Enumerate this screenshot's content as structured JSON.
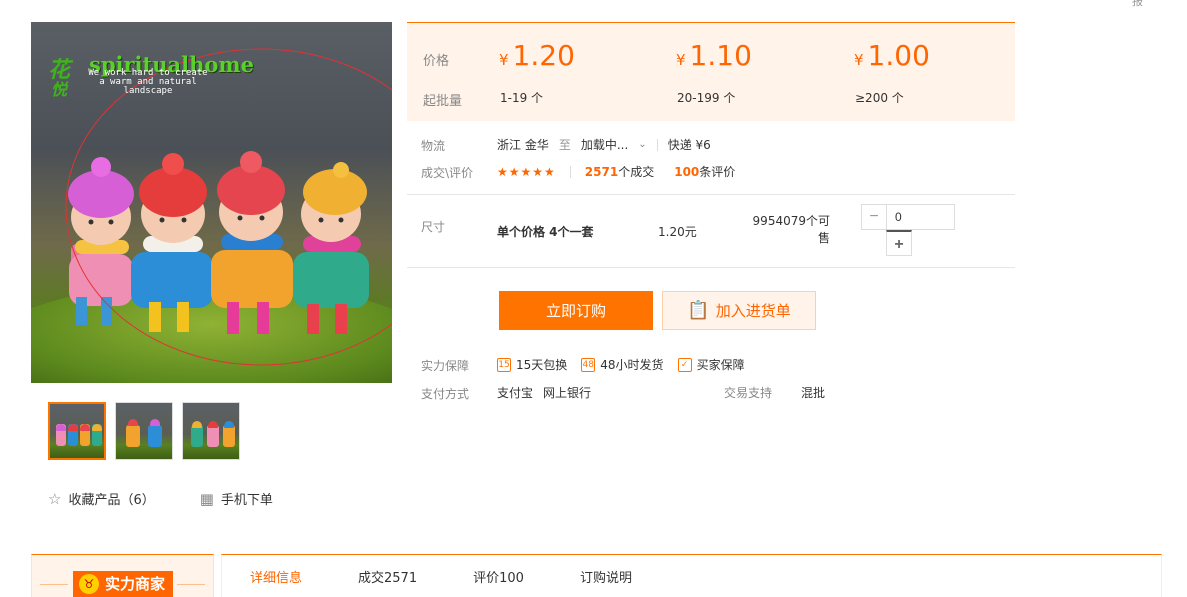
{
  "corner_text": "报",
  "brand": {
    "name": "spiritualhome",
    "tagline": "We work hard to create a warm and natural landscape",
    "glyph_1": "花",
    "glyph_2": "悦"
  },
  "thumbnails": [
    {
      "name": "thumb-1",
      "active": true
    },
    {
      "name": "thumb-2",
      "active": false
    },
    {
      "name": "thumb-3",
      "active": false
    }
  ],
  "actions": {
    "favorite_label": "收藏产品（6）",
    "mobile_label": "手机下单"
  },
  "price": {
    "price_label": "价格",
    "min_label": "起批量",
    "currency": "¥",
    "tiers": [
      {
        "price": "1.20",
        "qty": "1-19 个"
      },
      {
        "price": "1.10",
        "qty": "20-199 个"
      },
      {
        "price": "1.00",
        "qty": "≥200 个"
      }
    ]
  },
  "logistics": {
    "label": "物流",
    "from": "浙江 金华",
    "to_word": "至",
    "dest": "加载中...",
    "shipping": "快递 ¥6"
  },
  "deal": {
    "label": "成交\\评价",
    "stars": "★★★★★",
    "deal_count": "2571",
    "deal_suffix": "个成交",
    "review_count": "100",
    "review_suffix": "条评价"
  },
  "sku": {
    "label": "尺寸",
    "name": "单个价格 4个一套",
    "price": "1.20元",
    "stock": "9954079个可售",
    "qty_value": "0",
    "minus": "−",
    "plus": "+"
  },
  "buttons": {
    "order": "立即订购",
    "cart": "加入进货单"
  },
  "guarantee": {
    "label": "实力保障",
    "items": [
      "15天包换",
      "48小时发货",
      "买家保障"
    ],
    "icons": [
      "15",
      "48",
      "✓"
    ]
  },
  "payment": {
    "label": "支付方式",
    "methods": [
      "支付宝",
      "网上银行"
    ],
    "trade_label": "交易支持",
    "trade_value": "混批"
  },
  "seller": {
    "badge": "实力商家"
  },
  "tabs": [
    "详细信息",
    "成交2571",
    "评价100",
    "订购说明"
  ],
  "colors": {
    "accent": "#ff7300",
    "price": "#ff6500",
    "panel_bg": "#fff3ea"
  }
}
